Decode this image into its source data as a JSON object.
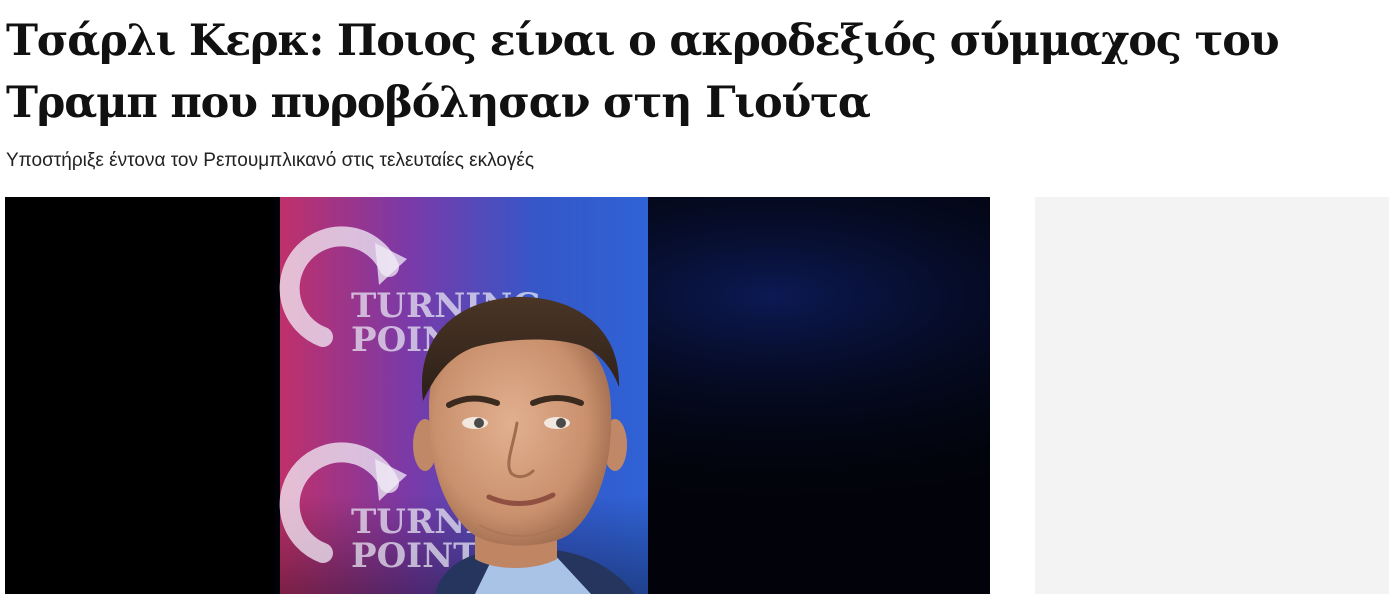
{
  "article": {
    "title": "Τσάρλι Κερκ: Ποιος είναι ο ακροδεξιός σύμμαχος του Τραμπ που πυροβόλησαν στη Γιούτα",
    "subtitle": "Υποστήριξε έντονα τον Ρεπουμπλικανό στις τελευταίες εκλογές"
  },
  "hero_image": {
    "backdrop_text": "TURNING POINT",
    "icon": "man-portrait-photo"
  },
  "colors": {
    "headline": "#111111",
    "subtitle": "#222222",
    "ad_background": "#f3f3f3"
  }
}
